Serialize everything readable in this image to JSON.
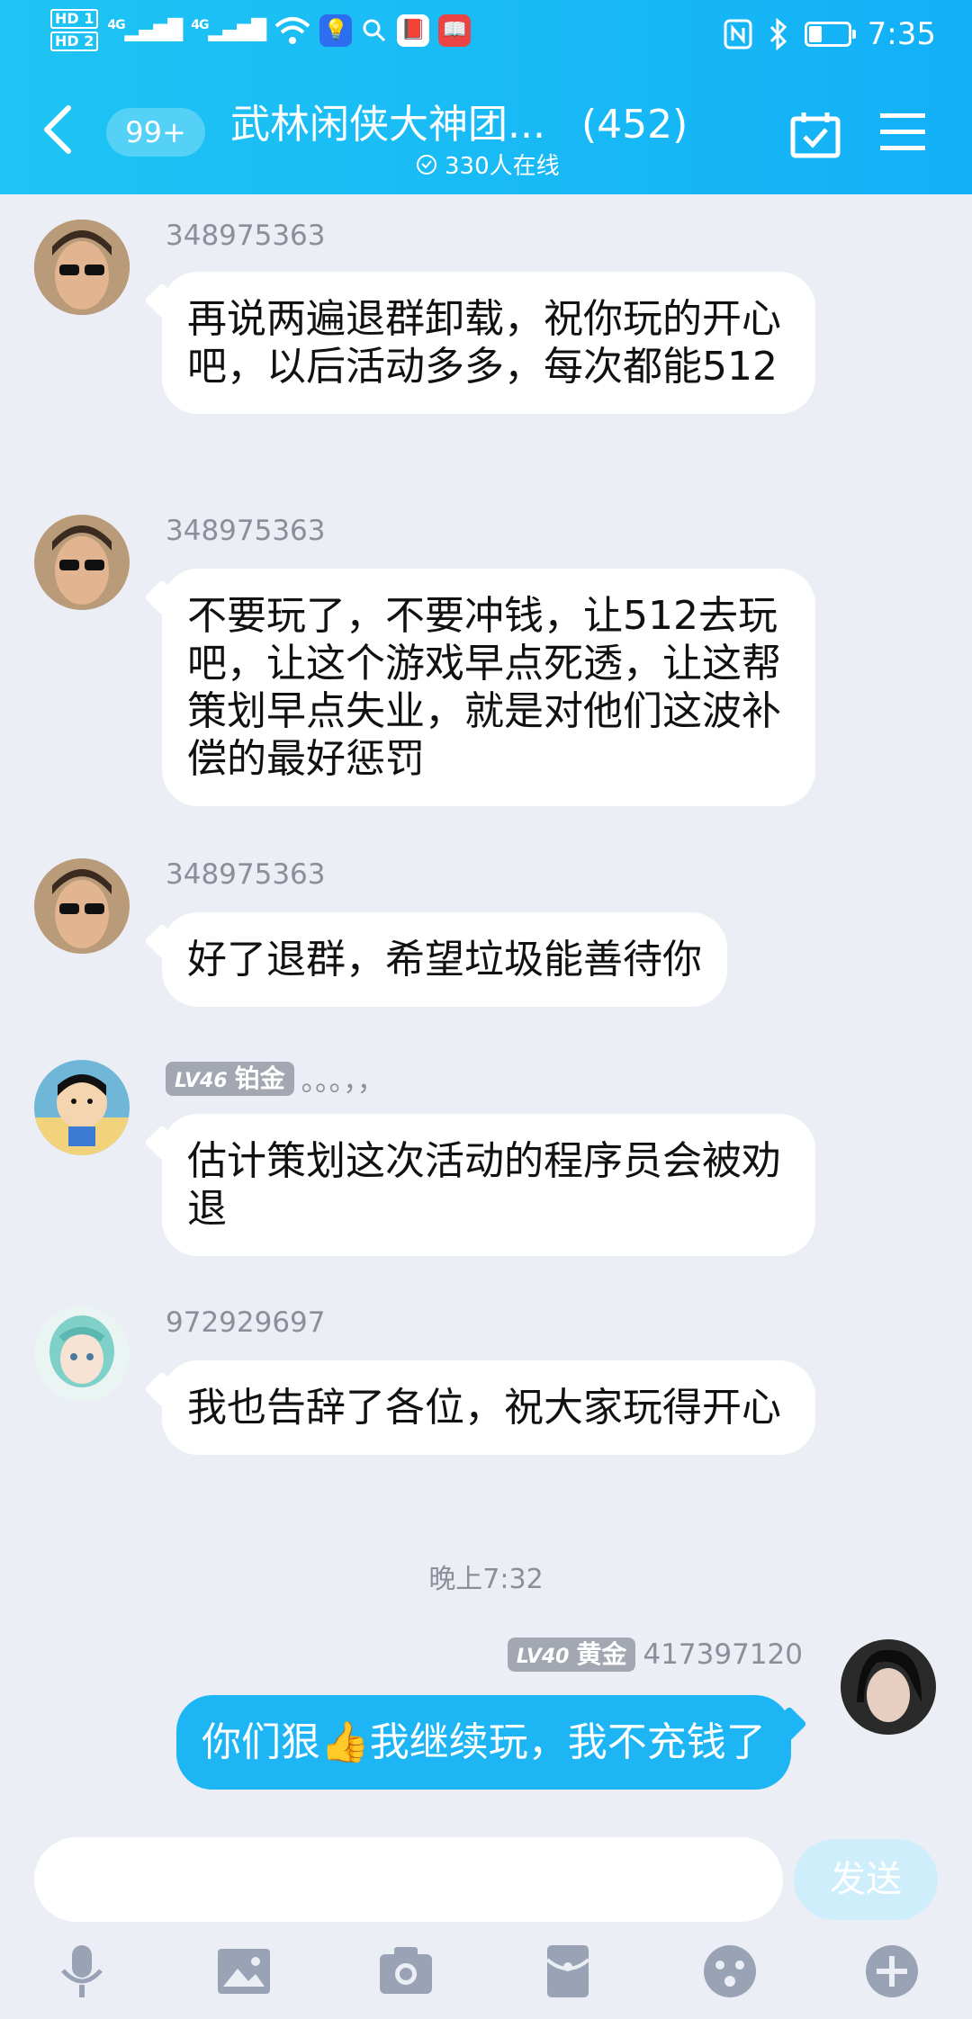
{
  "status_bar": {
    "hd1": "HD 1",
    "hd2": "HD 2",
    "signal1": "4G",
    "signal2": "4G",
    "time": "7:35"
  },
  "header": {
    "badge": "99+",
    "group_name": "武林闲侠大神团...",
    "member_count": "(452)",
    "online": "330人在线"
  },
  "messages": [
    {
      "sender": "348975363",
      "text": "再说两遍退群卸载，祝你玩的开心吧，以后活动多多，每次都能512"
    },
    {
      "sender": "348975363",
      "text": "不要玩了，不要冲钱，让512去玩吧，让这个游戏早点死透，让这帮策划早点失业，就是对他们这波补偿的最好惩罚"
    },
    {
      "sender": "348975363",
      "text": "好了退群，希望垃圾能善待你"
    },
    {
      "level": "LV46",
      "rank": "铂金",
      "sender": "。。。，，",
      "text": "估计策划这次活动的程序员会被劝退"
    },
    {
      "sender": "972929697",
      "text": "我也告辞了各位，祝大家玩得开心"
    }
  ],
  "timestamp": "晚上7:32",
  "my_message": {
    "level": "LV40",
    "rank": "黄金",
    "sender": "417397120",
    "text": "你们狠👍我继续玩，我不充钱了"
  },
  "composer": {
    "send_label": "发送"
  },
  "colors": {
    "header": "#1ec4f3",
    "my_bubble": "#1eb5f5",
    "background": "#ebeef5"
  }
}
